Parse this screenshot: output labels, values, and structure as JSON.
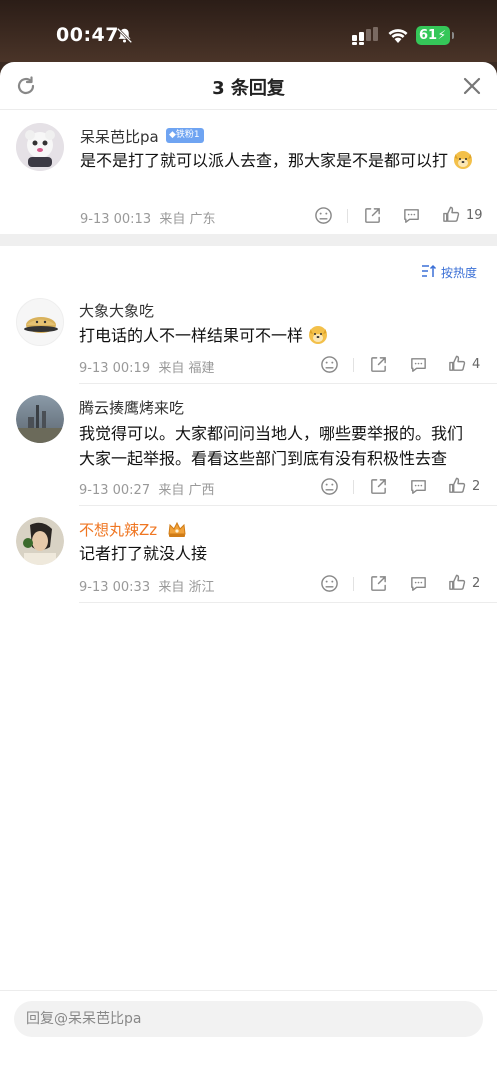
{
  "status_bar": {
    "time": "00:47",
    "battery": "61"
  },
  "sheet": {
    "title": "3 条回复"
  },
  "main_comment": {
    "username": "呆呆芭比pa",
    "badge": "铁粉1",
    "text": "是不是打了就可以派人去查，那大家是不是都可以打",
    "date": "9-13 00:13",
    "location": "来自 广东",
    "likes": "19"
  },
  "sort": {
    "label": "按热度"
  },
  "replies": [
    {
      "username": "大象大象吃",
      "text": "打电话的人不一样结果可不一样",
      "date": "9-13 00:19",
      "location": "来自 福建",
      "likes": "4"
    },
    {
      "username": "腾云揍鹰烤来吃",
      "text_line1": "我觉得可以。大家都问问当地人，哪些要举报的。我们",
      "text_line2": "大家一起举报。看看这些部门到底有没有积极性去查",
      "date": "9-13 00:27",
      "location": "来自 广西",
      "likes": "2"
    },
    {
      "username": "不想丸辣Zz",
      "text": "记者打了就没人接",
      "date": "9-13 00:33",
      "location": "来自 浙江",
      "likes": "2"
    }
  ],
  "reply_input": {
    "placeholder": "回复@呆呆芭比pa"
  },
  "colors": {
    "accent_blue": "#3a6fd6",
    "badge_blue": "#6fa4f2",
    "vip_name_orange": "#ef7622",
    "battery_green": "#35c759"
  },
  "icons": [
    "bell-off-icon",
    "signal-icon",
    "wifi-icon",
    "refresh-icon",
    "close-icon",
    "dislike-face-icon",
    "share-icon",
    "comment-icon",
    "like-icon",
    "sort-icon",
    "doge-emoji",
    "crown-icon"
  ]
}
